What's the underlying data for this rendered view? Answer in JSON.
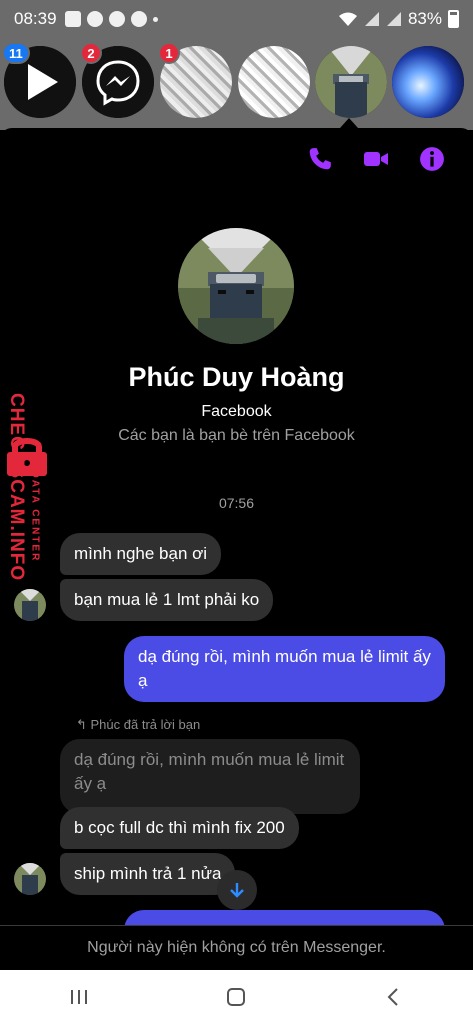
{
  "status_bar": {
    "time": "08:39",
    "battery": "83%"
  },
  "chat_heads": [
    {
      "name": "video-app-head",
      "badge": "11",
      "badge_color": "#1877f2"
    },
    {
      "name": "messenger-head",
      "badge": "2",
      "badge_color": "#e4283c"
    },
    {
      "name": "manga-head",
      "badge": "1",
      "badge_color": "#e4283c"
    },
    {
      "name": "manga-head-2",
      "badge": ""
    },
    {
      "name": "kakashi-head",
      "badge": ""
    },
    {
      "name": "blue-glow-head",
      "badge": ""
    }
  ],
  "header": {
    "icons": [
      "phone-icon",
      "video-call-icon",
      "info-icon"
    ],
    "accent": "#a033ff"
  },
  "profile": {
    "name": "Phúc Duy Hoàng",
    "source": "Facebook",
    "relation": "Các bạn là bạn bè trên Facebook"
  },
  "conversation": {
    "timestamp": "07:56",
    "messages": [
      {
        "dir": "in",
        "text": "mình nghe bạn ơi"
      },
      {
        "dir": "in",
        "text": "bạn mua lẻ 1 lmt phải ko"
      },
      {
        "dir": "out",
        "text": "dạ đúng rồi, mình muốn mua lẻ limit ấy ạ"
      },
      {
        "dir": "in",
        "text": "dạ đúng rồi, mình muốn mua lẻ limit ấy ạ",
        "quoted": true
      },
      {
        "dir": "in",
        "text": "b cọc full dc thì mình fix 200"
      },
      {
        "dir": "in",
        "text": "ship mình trả 1 nửa"
      }
    ],
    "reply_note": "Phúc đã trả lời bạn"
  },
  "footer": {
    "notice": "Người này hiện không có trên Messenger."
  },
  "watermark": {
    "main": "CHECKSCAM.INFO",
    "sub": "DATA CENTER",
    "color": "#e4283c"
  },
  "nav": [
    "recent-apps-icon",
    "home-icon",
    "back-icon"
  ]
}
